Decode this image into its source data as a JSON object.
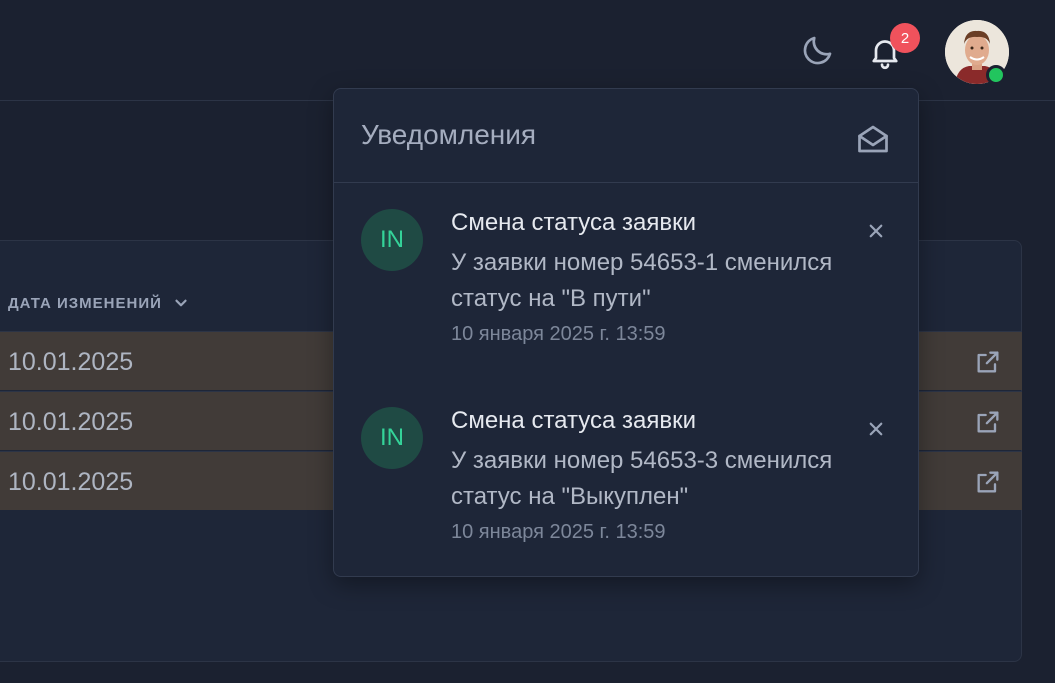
{
  "header": {
    "notification_count": "2",
    "theme_icon": "moon-icon",
    "bell_icon": "bell-icon",
    "status_color": "#22c55e"
  },
  "table": {
    "column_header": "ДАТА ИЗМЕНЕНИЙ",
    "rows": [
      {
        "date": "10.01.2025"
      },
      {
        "date": "10.01.2025"
      },
      {
        "date": "10.01.2025"
      }
    ]
  },
  "notifications_panel": {
    "title": "Уведомления",
    "items": [
      {
        "avatar_initials": "IN",
        "title": "Смена статуса заявки",
        "body": "У заявки номер 54653-1 сменился статус на \"В пути\"",
        "time": "10 января 2025 г. 13:59"
      },
      {
        "avatar_initials": "IN",
        "title": "Смена статуса заявки",
        "body": "У заявки номер 54653-3 сменился статус на \"Выкуплен\"",
        "time": "10 января 2025 г. 13:59"
      }
    ]
  },
  "colors": {
    "background": "#1b2130",
    "panel": "#1e2638",
    "row_highlight": "#413b38",
    "badge": "#f0525c",
    "avatar_bg": "#1f4a44",
    "avatar_text": "#34d399"
  }
}
